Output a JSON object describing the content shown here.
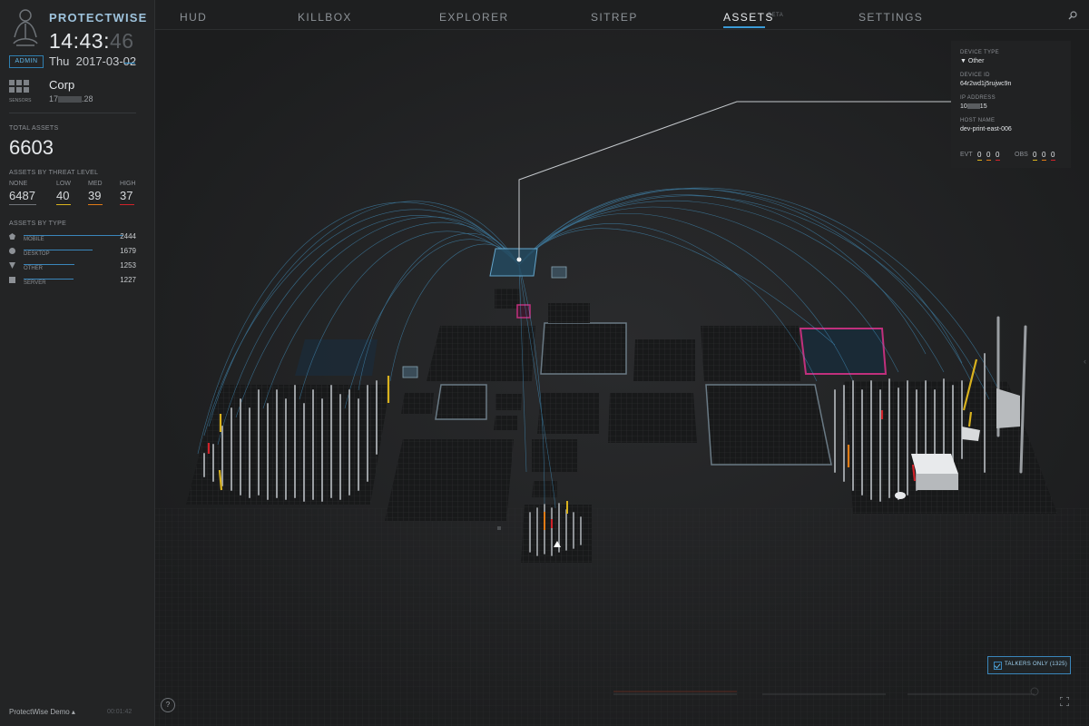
{
  "app": {
    "brand": "PROTECTWISE",
    "role_badge": "ADMIN",
    "clock": {
      "hm": "14:43",
      "sec": "46"
    },
    "date": {
      "day": "Thu",
      "value": "2017-03-02"
    }
  },
  "sensor": {
    "caption": "SENSORS",
    "name": "Corp",
    "ip_prefix": "17",
    "ip_suffix": ".28"
  },
  "stats": {
    "total_label": "TOTAL ASSETS",
    "total": "6603",
    "threat_label": "ASSETS BY THREAT LEVEL",
    "threat_levels": [
      {
        "label": "NONE",
        "value": "6487",
        "color": "#6f7378"
      },
      {
        "label": "LOW",
        "value": "40",
        "color": "#d9b21e"
      },
      {
        "label": "MED",
        "value": "39",
        "color": "#e07b16"
      },
      {
        "label": "HIGH",
        "value": "37",
        "color": "#d0232a"
      }
    ],
    "type_label": "ASSETS BY TYPE",
    "types": [
      {
        "icon": "mobile-icon",
        "label": "MOBILE",
        "count": "2444",
        "fraction": 1.0
      },
      {
        "icon": "desktop-icon",
        "label": "DESKTOP",
        "count": "1679",
        "fraction": 0.69
      },
      {
        "icon": "other-icon",
        "label": "OTHER",
        "count": "1253",
        "fraction": 0.51
      },
      {
        "icon": "server-icon",
        "label": "SERVER",
        "count": "1227",
        "fraction": 0.5
      }
    ]
  },
  "footer": {
    "account": "ProtectWise Demo ▴",
    "elapsed": "00:01:42"
  },
  "nav": {
    "items": [
      "HUD",
      "KILLBOX",
      "EXPLORER",
      "SITREP",
      "ASSETS",
      "SETTINGS"
    ],
    "active": "ASSETS",
    "beta": "BETA"
  },
  "info_panel": {
    "device_type_label": "DEVICE TYPE",
    "device_type": "Other",
    "device_id_label": "DEVICE ID",
    "device_id": "64r2wd1j5rujwc9n",
    "ip_label": "IP ADDRESS",
    "ip_prefix": "10",
    "ip_suffix": "15",
    "host_label": "HOST NAME",
    "host": "dev-print-east-006",
    "evt_label": "EVT",
    "obs_label": "OBS",
    "evt": [
      "0",
      "0",
      "0"
    ],
    "obs": [
      "0",
      "0",
      "0"
    ]
  },
  "controls": {
    "talkers": "TALKERS ONLY (1325)",
    "help": "?"
  },
  "colors": {
    "accent": "#3a9ad6",
    "arc": "#4aa6dc",
    "magenta": "#c0307c"
  }
}
